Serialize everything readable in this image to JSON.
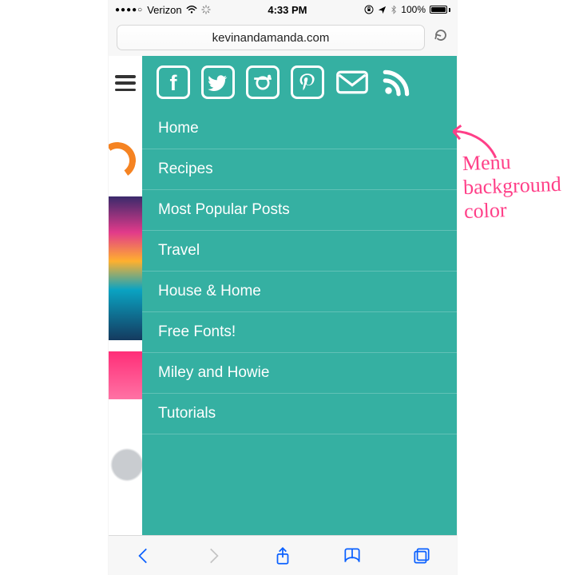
{
  "colors": {
    "menu_bg": "#35b0a2",
    "annotation": "#ff3f88",
    "ios_blue": "#0a60ff"
  },
  "statusbar": {
    "signal_dots": "●●●●○",
    "carrier": "Verizon",
    "time": "4:33 PM",
    "battery_pct": "100%"
  },
  "urlbar": {
    "domain": "kevinandamanda.com"
  },
  "social": {
    "items": [
      {
        "name": "facebook"
      },
      {
        "name": "twitter"
      },
      {
        "name": "instagram"
      },
      {
        "name": "pinterest"
      },
      {
        "name": "email"
      },
      {
        "name": "rss"
      }
    ]
  },
  "menu": {
    "items": [
      {
        "label": "Home"
      },
      {
        "label": "Recipes"
      },
      {
        "label": "Most Popular Posts"
      },
      {
        "label": "Travel"
      },
      {
        "label": "House & Home"
      },
      {
        "label": "Free Fonts!"
      },
      {
        "label": "Miley and Howie"
      },
      {
        "label": "Tutorials"
      }
    ]
  },
  "annotation": {
    "line1": "Menu",
    "line2": "background",
    "line3": "color"
  }
}
